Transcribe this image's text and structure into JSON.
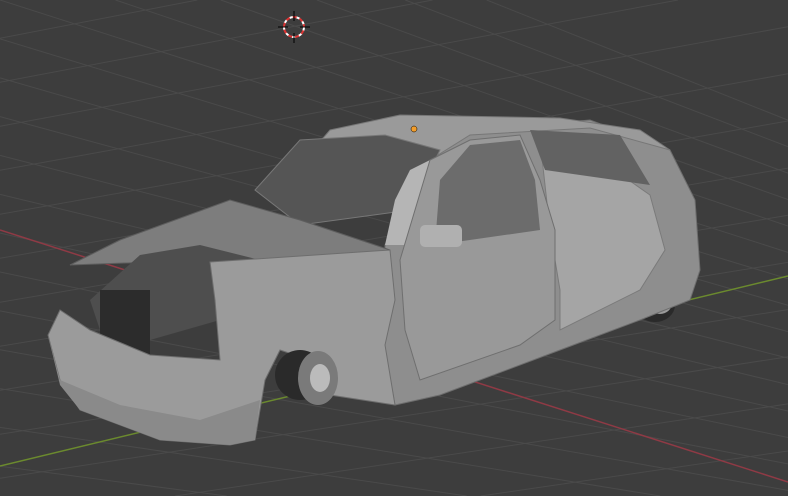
{
  "viewport": {
    "background": "#3d3d3d",
    "grid_color": "#4a4a4a",
    "x_axis_color": "#8f3a45",
    "y_axis_color": "#6b8a2e",
    "object_origin_color": "#f29d2b"
  },
  "icons": [
    "3d-cursor-icon",
    "object-origin-icon"
  ],
  "model": {
    "body_color": "#8e8e8e",
    "glass_color": "#5a5a5a",
    "engine_color": "#6a6a6a"
  }
}
